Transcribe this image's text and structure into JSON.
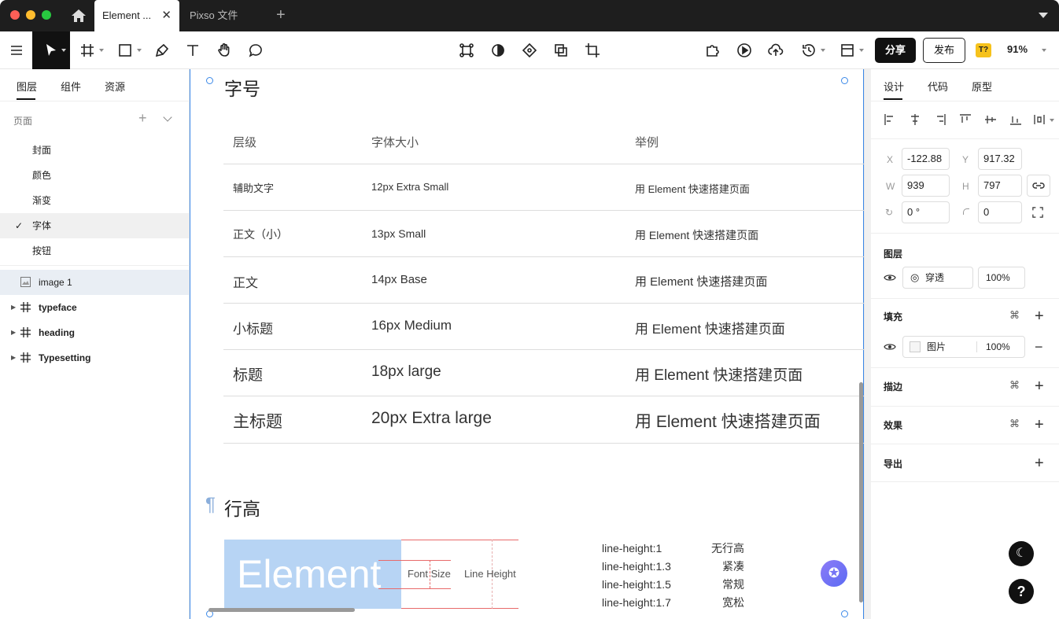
{
  "window": {
    "traffic_light_colors": [
      "#ff5f57",
      "#febc2e",
      "#28c840"
    ],
    "tabs": [
      {
        "label": "Element ...",
        "active": true
      },
      {
        "label": "Pixso 文件",
        "active": false
      }
    ]
  },
  "toolbar": {
    "share_label": "分享",
    "publish_label": "发布",
    "font_badge": "T?",
    "zoom": "91%"
  },
  "left_panel": {
    "tabs": [
      "图层",
      "组件",
      "资源"
    ],
    "pages_label": "页面",
    "pages": [
      "封面",
      "颜色",
      "渐变",
      "字体",
      "按钮"
    ],
    "selected_page": "字体",
    "layers": [
      "image 1",
      "typeface",
      "heading",
      "Typesetting"
    ]
  },
  "canvas": {
    "section_title": "字号",
    "table_headers": [
      "层级",
      "字体大小",
      "举例"
    ],
    "rows": [
      {
        "level": "辅助文字",
        "size": "12px Extra Small",
        "example": "用 Element 快速搭建页面"
      },
      {
        "level": "正文（小）",
        "size": "13px Small",
        "example": "用 Element 快速搭建页面"
      },
      {
        "level": "正文",
        "size": "14px Base",
        "example": "用 Element 快速搭建页面"
      },
      {
        "level": "小标题",
        "size": "16px Medium",
        "example": "用 Element 快速搭建页面"
      },
      {
        "level": "标题",
        "size": "18px large",
        "example": "用 Element 快速搭建页面"
      },
      {
        "level": "主标题",
        "size": "20px Extra large",
        "example": "用 Element 快速搭建页面"
      }
    ],
    "pilcrow": "¶",
    "section2_title": "行高",
    "demo_word": "Element",
    "demo_font_size_label": "Font Size",
    "demo_line_height_label": "Line Height",
    "line_heights": [
      {
        "value": "line-height:1",
        "desc": "无行高"
      },
      {
        "value": "line-height:1.3",
        "desc": "紧凑"
      },
      {
        "value": "line-height:1.5",
        "desc": "常规"
      },
      {
        "value": "line-height:1.7",
        "desc": "宽松"
      }
    ]
  },
  "right_panel": {
    "tabs": [
      "设计",
      "代码",
      "原型"
    ],
    "x_label": "X",
    "x": "-122.88",
    "y_label": "Y",
    "y": "917.32",
    "w_label": "W",
    "w": "939",
    "h_label": "H",
    "h": "797",
    "rotation": "0 °",
    "radius": "0",
    "layer_section": "图层",
    "blend_mode": "穿透",
    "layer_opacity": "100%",
    "fill_section": "填充",
    "fill_type": "图片",
    "fill_opacity": "100%",
    "stroke_section": "描边",
    "effect_section": "效果",
    "export_section": "导出",
    "help": "?"
  }
}
